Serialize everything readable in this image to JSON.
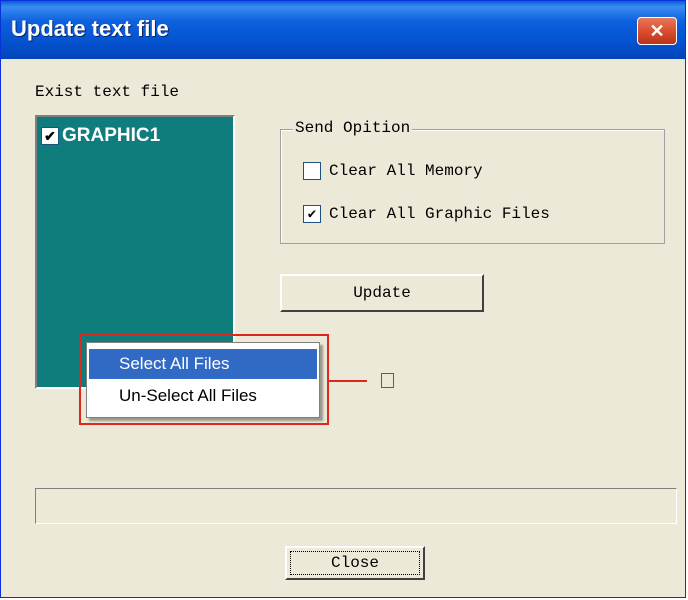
{
  "window": {
    "title": "Update text file",
    "close_symbol": "✕"
  },
  "file_list": {
    "label": "Exist text file",
    "items": [
      {
        "name": "GRAPHIC1",
        "checked": true
      }
    ]
  },
  "send_option": {
    "title": "Send Opition",
    "options": [
      {
        "label": "Clear All Memory",
        "checked": false
      },
      {
        "label": "Clear All Graphic Files",
        "checked": true
      }
    ]
  },
  "buttons": {
    "update": "Update",
    "close": "Close"
  },
  "context_menu": {
    "items": [
      {
        "label": "Select All Files",
        "selected": true
      },
      {
        "label": "Un-Select All Files",
        "selected": false
      }
    ]
  },
  "colors": {
    "list_bg": "#0f7d7c",
    "menu_highlight": "#316ac5",
    "annotation": "#e0271e"
  },
  "icons": {
    "check": "✔"
  }
}
